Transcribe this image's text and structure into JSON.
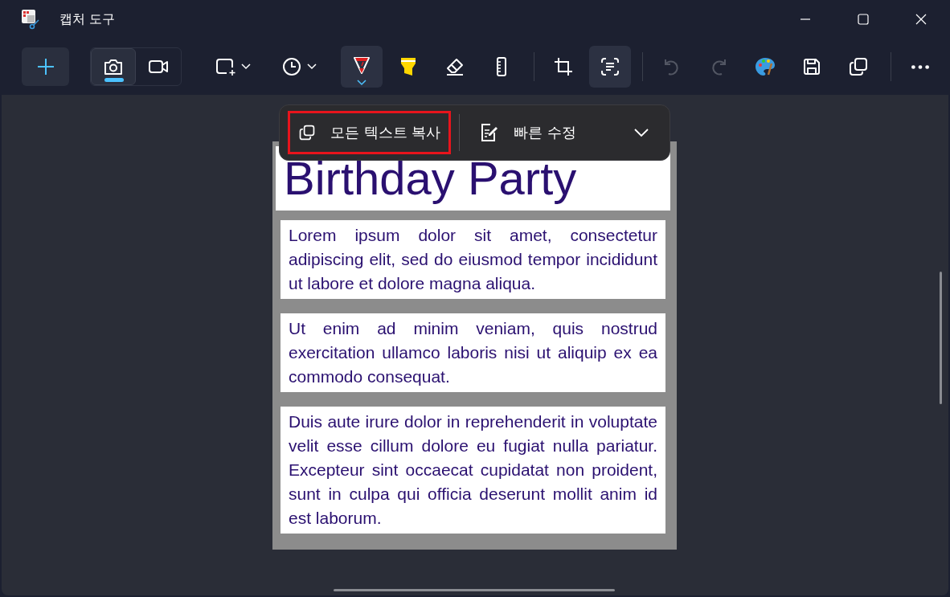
{
  "window": {
    "title": "캡처 도구"
  },
  "capture_modes": [
    {
      "kind": "photo",
      "selected": true
    },
    {
      "kind": "video",
      "selected": false
    }
  ],
  "tool_groups": [
    {
      "tools": [
        {
          "kind": "shape",
          "selected": false,
          "disabled": false
        },
        {
          "kind": "timer",
          "selected": false,
          "disabled": false
        },
        {
          "kind": "pen",
          "selected": true,
          "disabled": false
        },
        {
          "kind": "highlighter",
          "selected": false,
          "disabled": false
        },
        {
          "kind": "eraser",
          "selected": false,
          "disabled": false
        },
        {
          "kind": "ruler",
          "selected": false,
          "disabled": false
        }
      ]
    },
    {
      "tools": [
        {
          "kind": "crop",
          "selected": false,
          "disabled": false
        },
        {
          "kind": "text",
          "selected": true,
          "disabled": false
        }
      ]
    },
    {
      "tools": [
        {
          "kind": "undo",
          "selected": false,
          "disabled": true
        },
        {
          "kind": "redo",
          "selected": false,
          "disabled": true
        },
        {
          "kind": "paint",
          "selected": false,
          "disabled": false
        },
        {
          "kind": "save",
          "selected": false,
          "disabled": false
        },
        {
          "kind": "copy",
          "selected": false,
          "disabled": false
        }
      ]
    },
    {
      "tools": [
        {
          "kind": "more",
          "selected": false,
          "disabled": false
        }
      ]
    }
  ],
  "text_actions": [
    {
      "kind": "copy-all",
      "label": "모든 텍스트 복사",
      "highlighted": true
    },
    {
      "kind": "quick-edit",
      "label": "빠른 수정",
      "highlighted": false
    }
  ],
  "captured_image": {
    "title": "Birthday Party",
    "paragraphs": [
      "Lorem ipsum dolor sit amet, consectetur adipiscing elit, sed do eiusmod tempor incididunt ut labore et dolore magna aliqua.",
      "Ut enim ad minim veniam, quis nostrud exercitation ullamco laboris nisi ut aliquip ex ea commodo consequat.",
      "Duis aute irure dolor in reprehenderit in voluptate velit esse cillum dolore eu fugiat nulla pariatur. Excepteur sint occaecat cupidatat non proident, sunt in culpa qui officia deserunt mollit anim id est laborum."
    ]
  }
}
